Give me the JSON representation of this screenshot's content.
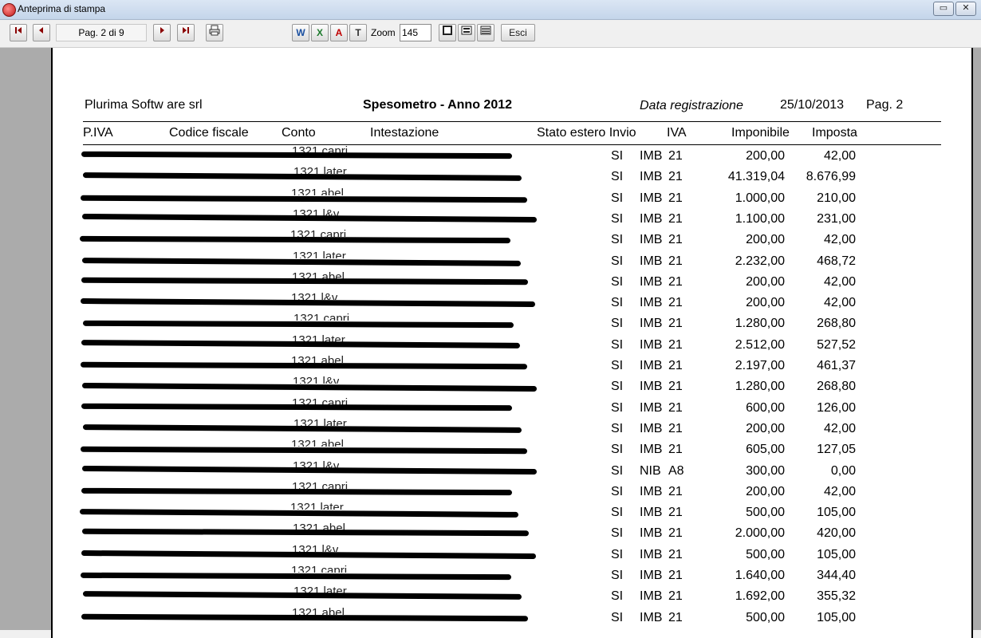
{
  "window": {
    "title": "Anteprima di stampa",
    "minimize": "▭",
    "close": "✕"
  },
  "toolbar": {
    "page_indicator": "Pag. 2 di 9",
    "zoom_label": "Zoom",
    "zoom_value": "145",
    "exit_label": "Esci",
    "export_word": "W",
    "export_excel": "X",
    "export_pdf": "A",
    "export_text": "T"
  },
  "report": {
    "company": "Plurima Softw are srl",
    "title": "Spesometro - Anno 2012",
    "date_label": "Data registrazione",
    "date_value": "25/10/2013",
    "page_label": "Pag. 2"
  },
  "columns": [
    "P.IVA",
    "Codice fiscale",
    "Conto",
    "Intestazione",
    "Stato estero Invio",
    "IVA",
    "Imponibile",
    "Imposta"
  ],
  "rows": [
    {
      "conto": "1321 capri",
      "invio": "SI",
      "tipo": "IMB",
      "iva": "21",
      "imponibile": "200,00",
      "imposta": "42,00"
    },
    {
      "conto": "1321 later",
      "invio": "SI",
      "tipo": "IMB",
      "iva": "21",
      "imponibile": "41.319,04",
      "imposta": "8.676,99"
    },
    {
      "conto": "1321 abel",
      "invio": "SI",
      "tipo": "IMB",
      "iva": "21",
      "imponibile": "1.000,00",
      "imposta": "210,00"
    },
    {
      "conto": "1321 l&v",
      "invio": "SI",
      "tipo": "IMB",
      "iva": "21",
      "imponibile": "1.100,00",
      "imposta": "231,00"
    },
    {
      "conto": "1321 capri",
      "invio": "SI",
      "tipo": "IMB",
      "iva": "21",
      "imponibile": "200,00",
      "imposta": "42,00"
    },
    {
      "conto": "1321 later",
      "invio": "SI",
      "tipo": "IMB",
      "iva": "21",
      "imponibile": "2.232,00",
      "imposta": "468,72"
    },
    {
      "conto": "1321 abel",
      "invio": "SI",
      "tipo": "IMB",
      "iva": "21",
      "imponibile": "200,00",
      "imposta": "42,00"
    },
    {
      "conto": "1321 l&v",
      "invio": "SI",
      "tipo": "IMB",
      "iva": "21",
      "imponibile": "200,00",
      "imposta": "42,00"
    },
    {
      "conto": "1321 capri",
      "invio": "SI",
      "tipo": "IMB",
      "iva": "21",
      "imponibile": "1.280,00",
      "imposta": "268,80"
    },
    {
      "conto": "1321 later",
      "invio": "SI",
      "tipo": "IMB",
      "iva": "21",
      "imponibile": "2.512,00",
      "imposta": "527,52"
    },
    {
      "conto": "1321 abel",
      "invio": "SI",
      "tipo": "IMB",
      "iva": "21",
      "imponibile": "2.197,00",
      "imposta": "461,37"
    },
    {
      "conto": "1321 l&v",
      "invio": "SI",
      "tipo": "IMB",
      "iva": "21",
      "imponibile": "1.280,00",
      "imposta": "268,80"
    },
    {
      "conto": "1321 capri",
      "invio": "SI",
      "tipo": "IMB",
      "iva": "21",
      "imponibile": "600,00",
      "imposta": "126,00"
    },
    {
      "conto": "1321 later",
      "invio": "SI",
      "tipo": "IMB",
      "iva": "21",
      "imponibile": "200,00",
      "imposta": "42,00"
    },
    {
      "conto": "1321 abel",
      "invio": "SI",
      "tipo": "IMB",
      "iva": "21",
      "imponibile": "605,00",
      "imposta": "127,05"
    },
    {
      "conto": "1321 l&v",
      "invio": "SI",
      "tipo": "NIB",
      "iva": "A8",
      "imponibile": "300,00",
      "imposta": "0,00"
    },
    {
      "conto": "1321 capri",
      "invio": "SI",
      "tipo": "IMB",
      "iva": "21",
      "imponibile": "200,00",
      "imposta": "42,00"
    },
    {
      "conto": "1321 later",
      "invio": "SI",
      "tipo": "IMB",
      "iva": "21",
      "imponibile": "500,00",
      "imposta": "105,00"
    },
    {
      "conto": "1321 abel",
      "invio": "SI",
      "tipo": "IMB",
      "iva": "21",
      "imponibile": "2.000,00",
      "imposta": "420,00"
    },
    {
      "conto": "1321 l&v",
      "invio": "SI",
      "tipo": "IMB",
      "iva": "21",
      "imponibile": "500,00",
      "imposta": "105,00"
    },
    {
      "conto": "1321 capri",
      "invio": "SI",
      "tipo": "IMB",
      "iva": "21",
      "imponibile": "1.640,00",
      "imposta": "344,40"
    },
    {
      "conto": "1321 later",
      "invio": "SI",
      "tipo": "IMB",
      "iva": "21",
      "imponibile": "1.692,00",
      "imposta": "355,32"
    },
    {
      "conto": "1321 abel",
      "invio": "SI",
      "tipo": "IMB",
      "iva": "21",
      "imponibile": "500,00",
      "imposta": "105,00"
    }
  ]
}
